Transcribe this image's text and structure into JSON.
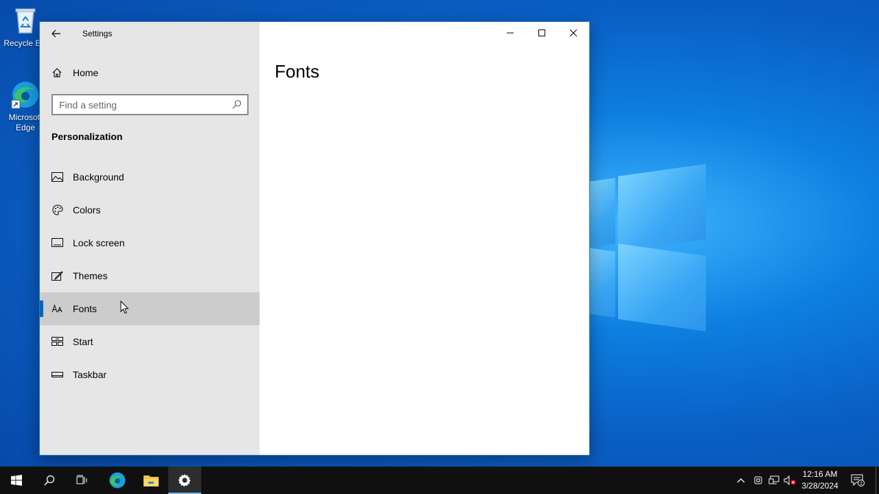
{
  "desktop": {
    "icons": [
      {
        "label": "Recycle Bin",
        "icon": "recycle-bin-icon"
      },
      {
        "label": "Microsoft Edge",
        "icon": "edge-icon"
      }
    ]
  },
  "window": {
    "app_title": "Settings",
    "home_label": "Home",
    "search_placeholder": "Find a setting",
    "section_title": "Personalization",
    "nav_items": [
      {
        "label": "Background",
        "icon": "picture-icon"
      },
      {
        "label": "Colors",
        "icon": "palette-icon"
      },
      {
        "label": "Lock screen",
        "icon": "lock-screen-icon"
      },
      {
        "label": "Themes",
        "icon": "themes-icon"
      },
      {
        "label": "Fonts",
        "icon": "fonts-icon",
        "active": true
      },
      {
        "label": "Start",
        "icon": "start-layout-icon"
      },
      {
        "label": "Taskbar",
        "icon": "taskbar-icon"
      }
    ],
    "page_title": "Fonts",
    "controls": [
      "minimize",
      "maximize",
      "close"
    ]
  },
  "taskbar": {
    "time": "12:16 AM",
    "date": "3/28/2024",
    "notification_count": "1",
    "apps": [
      "start",
      "search",
      "task-view",
      "edge",
      "file-explorer",
      "settings"
    ],
    "active_app": "settings"
  },
  "colors": {
    "accent": "#0067c0",
    "sidebar_bg": "#e6e6e6",
    "active_item_bg": "#cccccc",
    "taskbar_bg": "#101010"
  }
}
